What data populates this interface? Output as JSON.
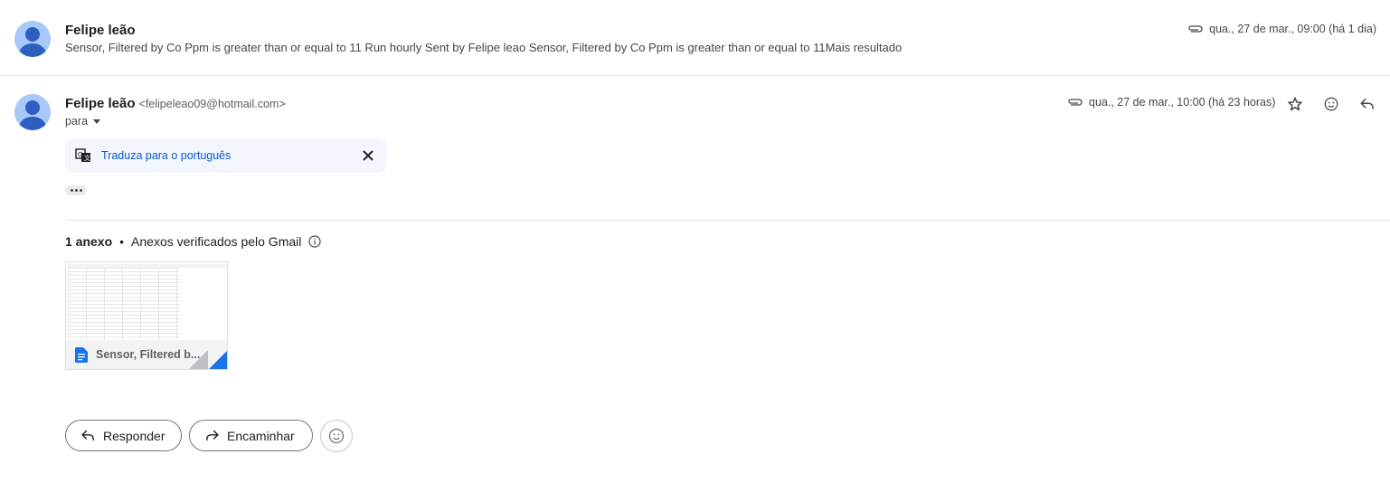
{
  "message1": {
    "sender": "Felipe leão",
    "snippet": "Sensor, Filtered by Co Ppm is greater than or equal to 11 Run hourly Sent by Felipe leao Sensor, Filtered by Co Ppm is greater than or equal to 11Mais resultado",
    "date": "qua., 27 de mar., 09:00 (há 1 dia)"
  },
  "message2": {
    "sender": "Felipe leão",
    "email": "<felipeleao09@hotmail.com>",
    "to_label": "para",
    "date": "qua., 27 de mar., 10:00 (há 23 horas)",
    "translate_label": "Traduza para o português"
  },
  "attachments": {
    "count_label": "1 anexo",
    "separator": "•",
    "verified_label": "Anexos verificados pelo Gmail",
    "file_name": "Sensor, Filtered b..."
  },
  "actions": {
    "reply_label": "Responder",
    "forward_label": "Encaminhar"
  },
  "icons": [
    "avatar-icon",
    "paperclip-icon",
    "star-icon",
    "emoji-icon",
    "reply-icon",
    "translate-icon",
    "close-icon",
    "info-icon",
    "doc-icon",
    "forward-icon"
  ],
  "colors": {
    "link_blue": "#0b57d0",
    "avatar_bg": "#a8c7fa",
    "avatar_fg": "#2d5fc1",
    "translate_bg": "#f2f6fc"
  }
}
